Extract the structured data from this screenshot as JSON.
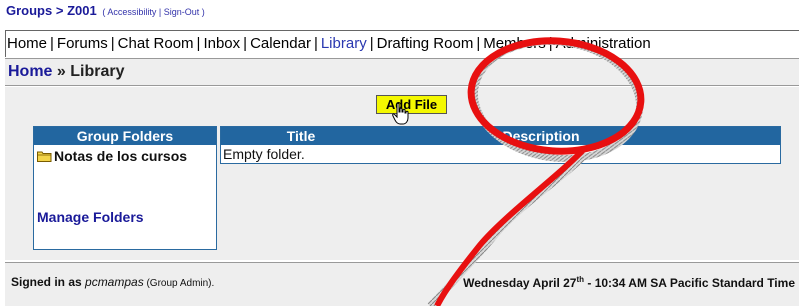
{
  "header": {
    "groups_link": "Groups",
    "separator": " > ",
    "group_name": "Z001",
    "open_paren": "( ",
    "accessibility_link": "Accessibility",
    "pipe": " | ",
    "signout_link": "Sign-Out",
    "close_paren": " )"
  },
  "nav": {
    "items": [
      {
        "label": "Home"
      },
      {
        "label": "Forums"
      },
      {
        "label": "Chat Room"
      },
      {
        "label": "Inbox"
      },
      {
        "label": "Calendar"
      },
      {
        "label": "Library",
        "active": true
      },
      {
        "label": "Drafting Room"
      },
      {
        "label": "Members"
      },
      {
        "label": "Administration"
      }
    ],
    "separator": "|"
  },
  "breadcrumb": {
    "home": "Home",
    "separator": " » ",
    "current": "Library"
  },
  "library": {
    "add_file_label": "Add File",
    "folders_panel": {
      "header": "Group Folders",
      "folder_name": "Notas de los cursos",
      "manage_label": "Manage Folders"
    },
    "files_table": {
      "col_title": "Title",
      "col_description": "Description",
      "empty_text": "Empty folder."
    }
  },
  "footer": {
    "signed_in_prefix": "Signed in as ",
    "username": "pcmampas",
    "role": " (Group Admin).",
    "date_prefix": "Wednesday April 27",
    "date_suffix": "th",
    "time": " - 10:34 AM SA Pacific Standard Time"
  },
  "colors": {
    "header_blue": "#2266a0",
    "link_blue": "#1a1a99",
    "add_file_yellow": "#f4f800",
    "annotation_red": "#e81010"
  },
  "icons": [
    "folder-icon",
    "hand-cursor-icon"
  ]
}
